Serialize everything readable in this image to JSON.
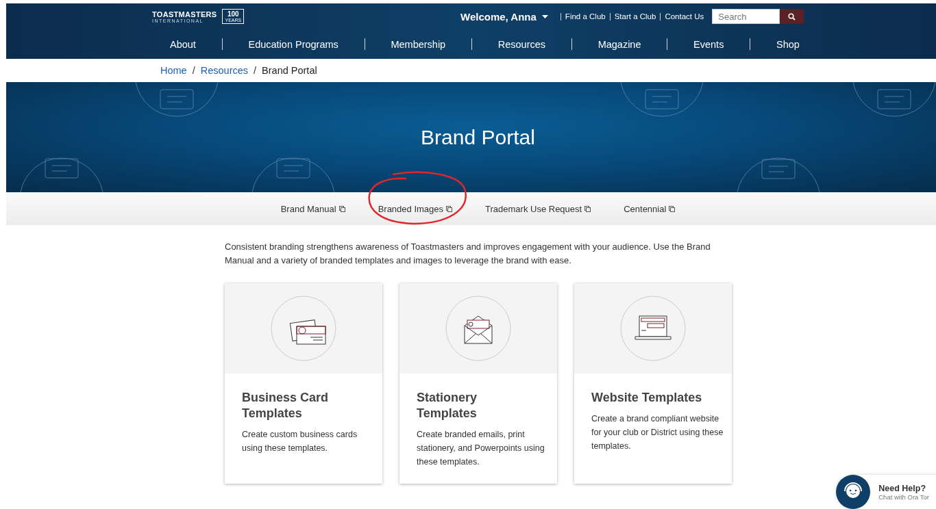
{
  "header": {
    "logo": {
      "name": "TOASTMASTERS",
      "sub": "INTERNATIONAL",
      "badge": "100",
      "badge_sub": "YEARS"
    },
    "welcome": "Welcome, Anna",
    "links": [
      "Find a Club",
      "Start a Club",
      "Contact Us"
    ],
    "search": {
      "placeholder": "Search"
    },
    "nav": [
      "About",
      "Education Programs",
      "Membership",
      "Resources",
      "Magazine",
      "Events",
      "Shop"
    ]
  },
  "breadcrumb": [
    {
      "kind": "link",
      "label": "Home"
    },
    {
      "kind": "separator",
      "label": "/"
    },
    {
      "kind": "link",
      "label": "Resources"
    },
    {
      "kind": "separator",
      "label": "/"
    },
    {
      "kind": "current",
      "label": "Brand Portal"
    }
  ],
  "hero": {
    "title": "Brand Portal"
  },
  "tabs": [
    {
      "label": "Brand Manual"
    },
    {
      "label": "Branded Images"
    },
    {
      "label": "Trademark Use Request"
    },
    {
      "label": "Centennial"
    }
  ],
  "intro": "Consistent branding strengthens awareness of Toastmasters and improves engagement with your audience. Use the Brand Manual and a variety of branded templates and images to leverage the brand with ease.",
  "cards": [
    {
      "kind": "business-card",
      "title": "Business Card Templates",
      "text": "Create custom business cards using these templates."
    },
    {
      "kind": "envelope",
      "title": "Stationery Templates",
      "text": "Create branded emails, print stationery, and Powerpoints using these templates."
    },
    {
      "kind": "laptop",
      "title": "Website Templates",
      "text": "Create a brand compliant website for your club or District using these templates."
    }
  ],
  "chat": {
    "title": "Need Help?",
    "subtitle": "Chat with Ora Tor"
  }
}
